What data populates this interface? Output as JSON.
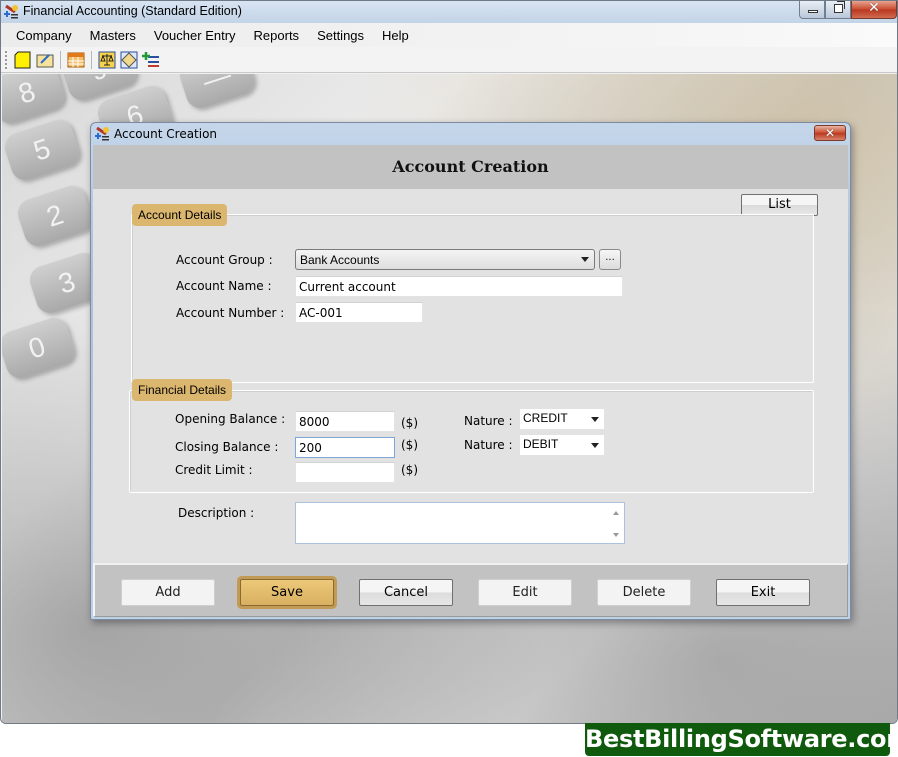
{
  "window": {
    "title": "Financial Accounting (Standard Edition)",
    "controls": {
      "minimize": "minimize",
      "maximize": "restore",
      "close": "close"
    }
  },
  "menu": [
    {
      "label": "Company"
    },
    {
      "label": "Masters"
    },
    {
      "label": "Voucher Entry"
    },
    {
      "label": "Reports"
    },
    {
      "label": "Settings"
    },
    {
      "label": "Help"
    }
  ],
  "toolbar": {
    "icons": [
      "new-file-icon",
      "open-folder-icon",
      "calendar-grid-icon",
      "balance-scale-icon",
      "ledger-note-icon",
      "add-list-icon"
    ]
  },
  "dialog": {
    "title": "Account Creation",
    "heading": "Account Creation",
    "list_button": "List",
    "account_details": {
      "legend": "Account Details",
      "group_label": "Account Group :",
      "group_value": "Bank Accounts",
      "browse_button": "...",
      "name_label": "Account Name :",
      "name_value": "Current account",
      "number_label": "Account Number :",
      "number_value": "AC-001"
    },
    "financial_details": {
      "legend": "Financial Details",
      "opening_label": "Opening Balance :",
      "opening_value": "8000",
      "closing_label": "Closing Balance :",
      "closing_value": "200",
      "credit_label": "Credit Limit :",
      "credit_value": "",
      "currency": "($)",
      "nature_label": "Nature :",
      "opening_nature": "CREDIT",
      "closing_nature": "DEBIT"
    },
    "description_label": "Description :",
    "description_value": "",
    "buttons": {
      "add": "Add",
      "save": "Save",
      "cancel": "Cancel",
      "edit": "Edit",
      "delete": "Delete",
      "exit": "Exit"
    }
  },
  "watermark": "BestBillingSoftware.com",
  "colors": {
    "legend_gold": "#dbb66f",
    "save_gold": "#d9b062",
    "brand_green": "#0f5a0c",
    "close_red": "#c8492e"
  }
}
